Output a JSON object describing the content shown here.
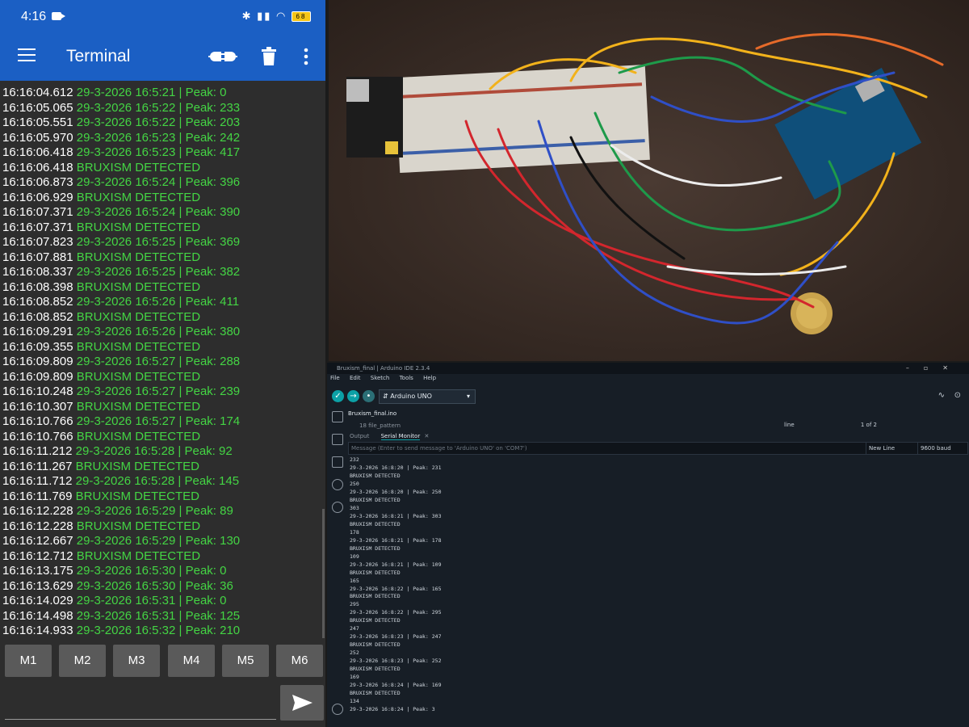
{
  "phone": {
    "status_bar": {
      "time": "4:16",
      "battery": "68"
    },
    "app_bar": {
      "title": "Terminal"
    },
    "log": [
      {
        "time": "16:16:04.612",
        "message": "29-3-2026 16:5:21 | Peak: 0"
      },
      {
        "time": "16:16:05.065",
        "message": "29-3-2026 16:5:22 | Peak: 233"
      },
      {
        "time": "16:16:05.551",
        "message": "29-3-2026 16:5:22 | Peak: 203"
      },
      {
        "time": "16:16:05.970",
        "message": "29-3-2026 16:5:23 | Peak: 242"
      },
      {
        "time": "16:16:06.418",
        "message": "29-3-2026 16:5:23 | Peak: 417"
      },
      {
        "time": "16:16:06.418",
        "message": "BRUXISM DETECTED"
      },
      {
        "time": "16:16:06.873",
        "message": "29-3-2026 16:5:24 | Peak: 396"
      },
      {
        "time": "16:16:06.929",
        "message": "BRUXISM DETECTED"
      },
      {
        "time": "16:16:07.371",
        "message": "29-3-2026 16:5:24 | Peak: 390"
      },
      {
        "time": "16:16:07.371",
        "message": "BRUXISM DETECTED"
      },
      {
        "time": "16:16:07.823",
        "message": "29-3-2026 16:5:25 | Peak: 369"
      },
      {
        "time": "16:16:07.881",
        "message": "BRUXISM DETECTED"
      },
      {
        "time": "16:16:08.337",
        "message": "29-3-2026 16:5:25 | Peak: 382"
      },
      {
        "time": "16:16:08.398",
        "message": "BRUXISM DETECTED"
      },
      {
        "time": "16:16:08.852",
        "message": "29-3-2026 16:5:26 | Peak: 411"
      },
      {
        "time": "16:16:08.852",
        "message": "BRUXISM DETECTED"
      },
      {
        "time": "16:16:09.291",
        "message": "29-3-2026 16:5:26 | Peak: 380"
      },
      {
        "time": "16:16:09.355",
        "message": "BRUXISM DETECTED"
      },
      {
        "time": "16:16:09.809",
        "message": "29-3-2026 16:5:27 | Peak: 288"
      },
      {
        "time": "16:16:09.809",
        "message": "BRUXISM DETECTED"
      },
      {
        "time": "16:16:10.248",
        "message": "29-3-2026 16:5:27 | Peak: 239"
      },
      {
        "time": "16:16:10.307",
        "message": "BRUXISM DETECTED"
      },
      {
        "time": "16:16:10.766",
        "message": "29-3-2026 16:5:27 | Peak: 174"
      },
      {
        "time": "16:16:10.766",
        "message": "BRUXISM DETECTED"
      },
      {
        "time": "16:16:11.212",
        "message": "29-3-2026 16:5:28 | Peak: 92"
      },
      {
        "time": "16:16:11.267",
        "message": "BRUXISM DETECTED"
      },
      {
        "time": "16:16:11.712",
        "message": "29-3-2026 16:5:28 | Peak: 145"
      },
      {
        "time": "16:16:11.769",
        "message": "BRUXISM DETECTED"
      },
      {
        "time": "16:16:12.228",
        "message": "29-3-2026 16:5:29 | Peak: 89"
      },
      {
        "time": "16:16:12.228",
        "message": "BRUXISM DETECTED"
      },
      {
        "time": "16:16:12.667",
        "message": "29-3-2026 16:5:29 | Peak: 130"
      },
      {
        "time": "16:16:12.712",
        "message": "BRUXISM DETECTED"
      },
      {
        "time": "16:16:13.175",
        "message": "29-3-2026 16:5:30 | Peak: 0"
      },
      {
        "time": "16:16:13.629",
        "message": "29-3-2026 16:5:30 | Peak: 36"
      },
      {
        "time": "16:16:14.029",
        "message": "29-3-2026 16:5:31 | Peak: 0"
      },
      {
        "time": "16:16:14.498",
        "message": "29-3-2026 16:5:31 | Peak: 125"
      },
      {
        "time": "16:16:14.933",
        "message": "29-3-2026 16:5:32 | Peak: 210"
      }
    ],
    "macros": [
      "M1",
      "M2",
      "M3",
      "M4",
      "M5",
      "M6"
    ],
    "send_input": {
      "value": ""
    }
  },
  "icons": {
    "menu": "hamburger-icon",
    "connect": "plug-icon",
    "delete": "trash-icon",
    "more": "more-vert-icon",
    "send": "send-icon"
  },
  "ide": {
    "title": "Bruxism_final | Arduino IDE 2.3.4",
    "menu": [
      "File",
      "Edit",
      "Sketch",
      "Tools",
      "Help"
    ],
    "board": "Arduino UNO",
    "file_tab": "Bruxism_final.ino",
    "editor_line": "18     file_pattern",
    "find": {
      "value": "line",
      "result": "1 of 2"
    },
    "panel_tabs": [
      "Output",
      "Serial Monitor"
    ],
    "message_placeholder": "Message (Enter to send message to 'Arduino UNO' on 'COM7')",
    "line_ending": "New Line",
    "baud": "9600 baud",
    "serial_lines": [
      "232",
      "29-3-2026 16:8:20 | Peak: 231",
      "BRUXISM DETECTED",
      "250",
      "29-3-2026 16:8:20 | Peak: 250",
      "BRUXISM DETECTED",
      "303",
      "29-3-2026 16:8:21 | Peak: 303",
      "BRUXISM DETECTED",
      "178",
      "29-3-2026 16:8:21 | Peak: 178",
      "BRUXISM DETECTED",
      "109",
      "29-3-2026 16:8:21 | Peak: 109",
      "BRUXISM DETECTED",
      "165",
      "29-3-2026 16:8:22 | Peak: 165",
      "BRUXISM DETECTED",
      "295",
      "29-3-2026 16:8:22 | Peak: 295",
      "BRUXISM DETECTED",
      "247",
      "29-3-2026 16:8:23 | Peak: 247",
      "BRUXISM DETECTED",
      "252",
      "29-3-2026 16:8:23 | Peak: 252",
      "BRUXISM DETECTED",
      "169",
      "29-3-2026 16:8:24 | Peak: 169",
      "BRUXISM DETECTED",
      "134",
      "29-3-2026 16:8:24 | Peak: 3"
    ]
  },
  "colors": {
    "appbar": "#1b5fc4",
    "terminal_bg": "#2d2d2d",
    "log_text": "#44d544",
    "ide_bg": "#171e26",
    "ide_accent": "#0ca1a6"
  }
}
